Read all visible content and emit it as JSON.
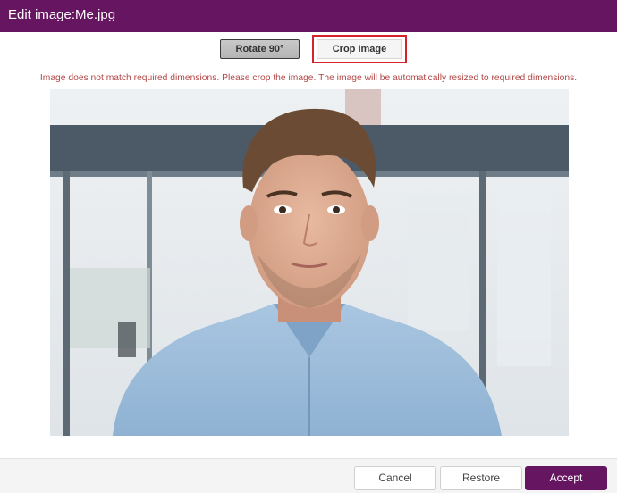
{
  "dialog": {
    "title": "Edit image:Me.jpg"
  },
  "toolbar": {
    "rotate_label": "Rotate 90°",
    "crop_label": "Crop Image"
  },
  "message": {
    "warning": "Image does not match required dimensions. Please crop the image. The image will be automatically resized to required dimensions."
  },
  "image": {
    "name": "Me.jpg",
    "subject": "portrait-photo"
  },
  "footer": {
    "cancel_label": "Cancel",
    "restore_label": "Restore",
    "accept_label": "Accept"
  },
  "colors": {
    "brand": "#661560",
    "highlight": "#d42429",
    "warning_text": "#b14646"
  }
}
